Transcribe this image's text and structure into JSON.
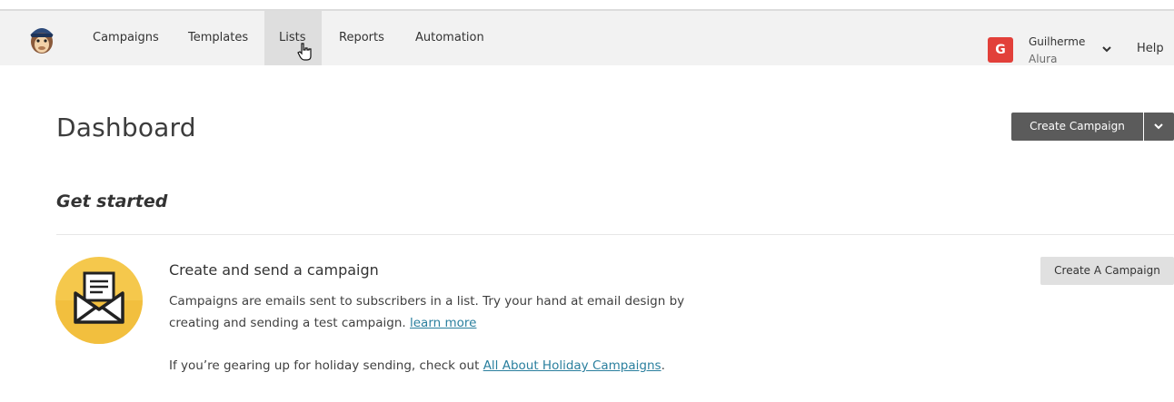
{
  "nav": {
    "items": [
      {
        "label": "Campaigns"
      },
      {
        "label": "Templates"
      },
      {
        "label": "Lists"
      },
      {
        "label": "Reports"
      },
      {
        "label": "Automation"
      }
    ],
    "active": "Lists",
    "logo_icon": "freddie-chimp-logo-icon",
    "cursor_icon": "hand-pointer-icon"
  },
  "user": {
    "avatar_letter": "G",
    "name": "Guilherme",
    "org": "Alura",
    "avatar_color": "#e2403a"
  },
  "help_label": "Help",
  "page": {
    "title": "Dashboard",
    "create_button_label": "Create Campaign"
  },
  "get_started": {
    "title": "Get started",
    "card": {
      "icon": "envelope-icon",
      "title": "Create and send a campaign",
      "body_text": "Campaigns are emails sent to subscribers in a list. Try your hand at email design by creating and sending a test campaign.",
      "learn_more_label": "learn more",
      "note_prefix": "If you’re gearing up for holiday sending, check out ",
      "note_link": "All About Holiday Campaigns",
      "note_suffix": ".",
      "button_label": "Create A Campaign"
    }
  },
  "colors": {
    "accent_link": "#2a7f9e",
    "dark_button": "#5b5b5b",
    "icon_yellow": "#f5c84c"
  }
}
